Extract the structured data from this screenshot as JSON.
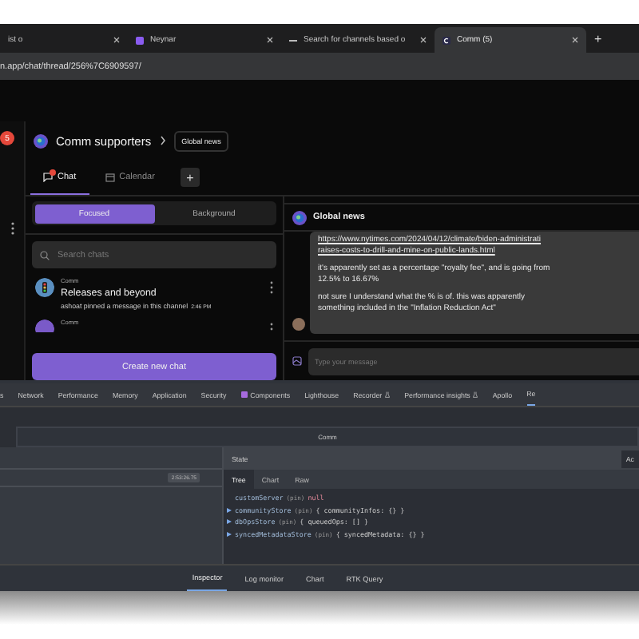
{
  "browser": {
    "tabs": [
      {
        "title": "ist o",
        "selected": false,
        "kind": "plain"
      },
      {
        "title": "Neynar",
        "selected": false,
        "kind": "neynar"
      },
      {
        "title": "Search for channels based o",
        "selected": false,
        "kind": "dash"
      },
      {
        "title": "Comm (5)",
        "selected": true,
        "kind": "comm"
      }
    ],
    "new_tab": "+",
    "address": "n.app/chat/thread/256%7C6909597/"
  },
  "app_sidebar": {
    "badge": "5"
  },
  "header": {
    "community": "Comm supporters",
    "channel": "Global news"
  },
  "nav_tabs": [
    {
      "label": "Chat",
      "selected": true,
      "unread": true
    },
    {
      "label": "Calendar",
      "selected": false,
      "unread": false
    }
  ],
  "add_tab": "+",
  "segments": [
    {
      "label": "Focused",
      "selected": true
    },
    {
      "label": "Background",
      "selected": false
    }
  ],
  "search": {
    "placeholder": "Search chats"
  },
  "chats": [
    {
      "community": "Comm",
      "title": "Releases and beyond",
      "preview": "ashoat pinned a message in this channel",
      "time": "2:46 PM"
    },
    {
      "community": "Comm"
    }
  ],
  "create_button": "Create new chat",
  "thread": {
    "title": "Global news",
    "link_lines": [
      "https://www.nytimes.com/2024/04/12/climate/biden-administrati",
      "raises-costs-to-drill-and-mine-on-public-lands.html"
    ],
    "paragraphs": [
      [
        "it's apparently set as a percentage \"royalty fee\", and is going from",
        "12.5% to 16.67%"
      ],
      [
        "not sure I understand what the % is of. this was apparently",
        "something included in the \"Inflation Reduction Act\""
      ]
    ]
  },
  "composer": {
    "placeholder": "Type your message"
  },
  "devtools": {
    "tabs": [
      {
        "label": "s",
        "kind": "plain",
        "selected": false
      },
      {
        "label": "Network",
        "kind": "plain",
        "selected": false
      },
      {
        "label": "Performance",
        "kind": "plain",
        "selected": false
      },
      {
        "label": "Memory",
        "kind": "plain",
        "selected": false
      },
      {
        "label": "Application",
        "kind": "plain",
        "selected": false
      },
      {
        "label": "Security",
        "kind": "plain",
        "selected": false
      },
      {
        "label": "Components",
        "kind": "extension",
        "selected": false
      },
      {
        "label": "Lighthouse",
        "kind": "plain",
        "selected": false
      },
      {
        "label": "Recorder",
        "kind": "experimental",
        "selected": false
      },
      {
        "label": "Performance insights",
        "kind": "experimental",
        "selected": false
      },
      {
        "label": "Apollo",
        "kind": "plain",
        "selected": false
      },
      {
        "label": "Re",
        "kind": "plain",
        "selected": true
      }
    ],
    "instance": "Comm",
    "time": "2:53:26.75",
    "state_title": "State",
    "action_button": "Ac",
    "state_tabs": [
      {
        "label": "Tree",
        "selected": true
      },
      {
        "label": "Chart",
        "selected": false
      },
      {
        "label": "Raw",
        "selected": false
      }
    ],
    "tree": [
      {
        "key": "customServer",
        "tag": "(pin)",
        "value": "null",
        "expandable": false
      },
      {
        "key": "communityStore",
        "tag": "(pin)",
        "value": "{ communityInfos: {} }",
        "expandable": true
      },
      {
        "key": "dbOpsStore",
        "tag": "(pin)",
        "value": "{ queuedOps: [] }",
        "expandable": true
      },
      {
        "key": "syncedMetadataStore",
        "tag": "(pin)",
        "value": "{ syncedMetadata: {} }",
        "expandable": true
      }
    ],
    "bottom_tabs": [
      {
        "label": "Inspector",
        "selected": true
      },
      {
        "label": "Log monitor",
        "selected": false
      },
      {
        "label": "Chart",
        "selected": false
      },
      {
        "label": "RTK Query",
        "selected": false
      }
    ]
  }
}
